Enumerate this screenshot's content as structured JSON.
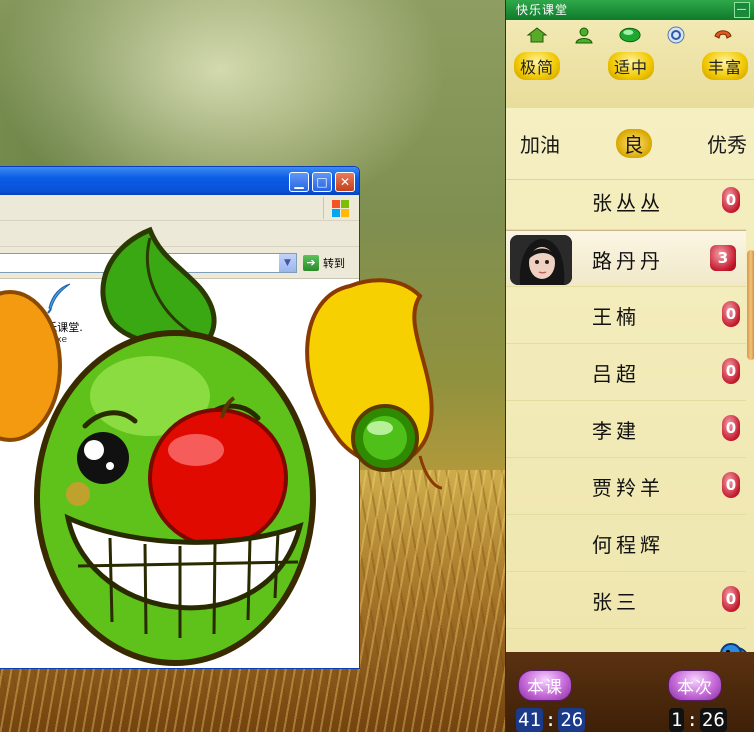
{
  "explorer": {
    "go_label": "转到",
    "file": {
      "name": "快乐课堂.",
      "ext": "exe"
    }
  },
  "panel": {
    "title": "快乐课堂",
    "tool_icons": [
      "home-icon",
      "user-icon",
      "green-ball-icon",
      "refresh-icon",
      "phone-icon"
    ],
    "modes": [
      "极简",
      "适中",
      "丰富"
    ],
    "ratings": [
      "加油",
      "良",
      "优秀"
    ],
    "selected_rating": "良",
    "students": [
      {
        "name": "张丛丛",
        "score": "0"
      },
      {
        "name": "路丹丹",
        "score": "3"
      },
      {
        "name": "王楠",
        "score": "0"
      },
      {
        "name": "吕超",
        "score": "0"
      },
      {
        "name": "李建",
        "score": "0"
      },
      {
        "name": "贾羚羊",
        "score": "0"
      },
      {
        "name": "何程辉",
        "score": ""
      },
      {
        "name": "张三",
        "score": "0"
      }
    ],
    "active_student_index": 1,
    "buttons": {
      "lesson": "本课",
      "session": "本次"
    },
    "timers": {
      "lesson": {
        "min": "41",
        "sec": "26"
      },
      "session": {
        "min": "1",
        "sec": "26"
      }
    }
  },
  "colors": {
    "panel_bg": "#f5efc2",
    "title_green": "#1a8a3a",
    "score_red": "#c4192e",
    "accent_gold": "#f0c800"
  }
}
